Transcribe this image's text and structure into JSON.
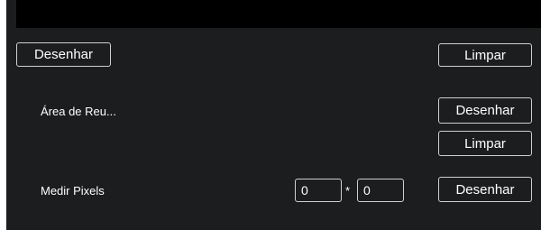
{
  "top_row": {
    "draw_label": "Desenhar",
    "clear_label": "Limpar"
  },
  "meeting_area": {
    "label": "Área de Reu...",
    "draw_label": "Desenhar",
    "clear_label": "Limpar"
  },
  "measure_pixels": {
    "label": "Medir Pixels",
    "width_value": "0",
    "separator": "*",
    "height_value": "0",
    "draw_label": "Desenhar"
  }
}
